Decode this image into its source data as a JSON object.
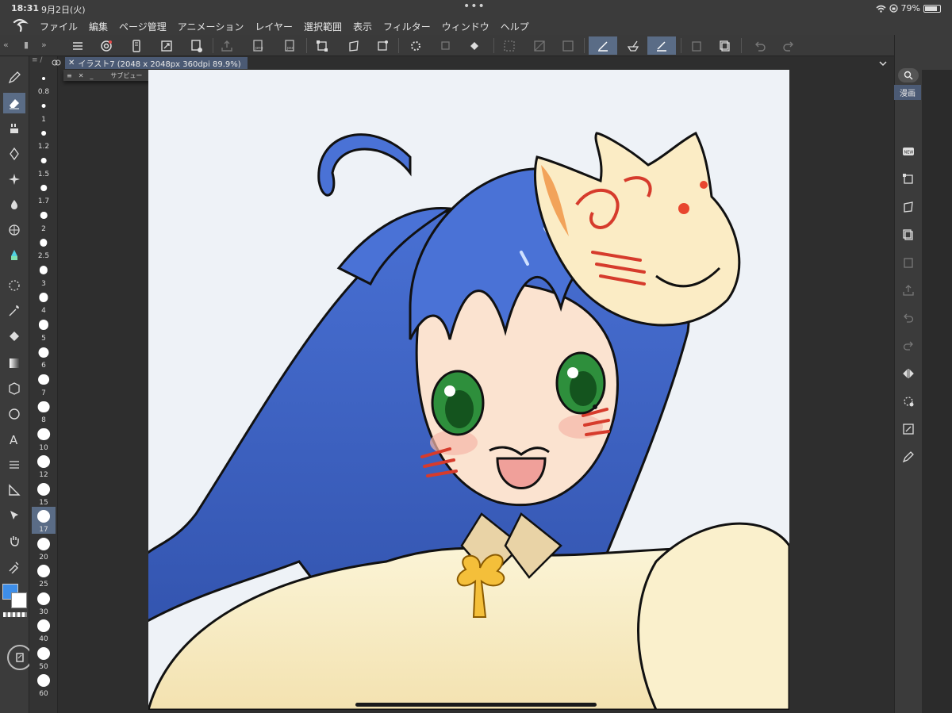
{
  "status_bar": {
    "time": "18:31",
    "date": "9月2日(火)",
    "battery": "79%"
  },
  "menu": {
    "items": [
      "ファイル",
      "編集",
      "ページ管理",
      "アニメーション",
      "レイヤー",
      "選択範囲",
      "表示",
      "フィルター",
      "ウィンドウ",
      "ヘルプ"
    ]
  },
  "document": {
    "tab_title": "イラスト7 (2048 x 2048px 360dpi 89.9%)",
    "sub_view_label": "サブビュー"
  },
  "brush_sizes": [
    "0.8",
    "1",
    "1.2",
    "1.5",
    "1.7",
    "2",
    "2.5",
    "3",
    "4",
    "5",
    "6",
    "7",
    "8",
    "10",
    "12",
    "15",
    "17",
    "20",
    "25",
    "30",
    "40",
    "50",
    "60"
  ],
  "active_brush_size": "17",
  "right_panel": {
    "tab_label": "漫画"
  },
  "colors": {
    "accent": "#5a6c86",
    "main_color": "#3e8ee8",
    "sub_color": "#ffffff",
    "hair": "#3c63c8",
    "canvas_bg": "#eef2f7"
  }
}
